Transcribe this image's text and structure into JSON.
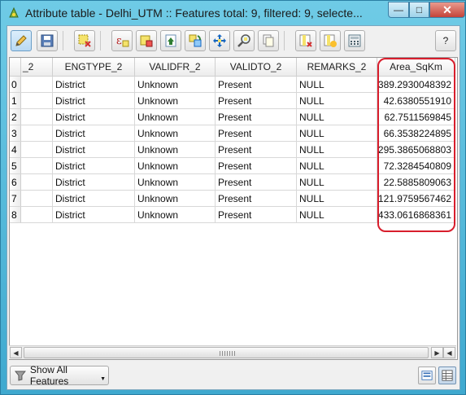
{
  "window": {
    "title": "Attribute table - Delhi_UTM :: Features total: 9, filtered: 9, selecte...",
    "minimize_glyph": "—",
    "maximize_glyph": "□",
    "close_glyph": "✕"
  },
  "toolbar": {
    "help_label": "?"
  },
  "table": {
    "columns": [
      "_2",
      "ENGTYPE_2",
      "VALIDFR_2",
      "VALIDTO_2",
      "REMARKS_2",
      "Area_SqKm"
    ],
    "rows": [
      {
        "id": "0",
        "cells": [
          "",
          "District",
          "Unknown",
          "Present",
          "NULL",
          "389.2930048392"
        ]
      },
      {
        "id": "1",
        "cells": [
          "",
          "District",
          "Unknown",
          "Present",
          "NULL",
          "42.6380551910"
        ]
      },
      {
        "id": "2",
        "cells": [
          "",
          "District",
          "Unknown",
          "Present",
          "NULL",
          "62.7511569845"
        ]
      },
      {
        "id": "3",
        "cells": [
          "",
          "District",
          "Unknown",
          "Present",
          "NULL",
          "66.3538224895"
        ]
      },
      {
        "id": "4",
        "cells": [
          "",
          "District",
          "Unknown",
          "Present",
          "NULL",
          "295.3865068803"
        ]
      },
      {
        "id": "5",
        "cells": [
          "",
          "District",
          "Unknown",
          "Present",
          "NULL",
          "72.3284540809"
        ]
      },
      {
        "id": "6",
        "cells": [
          "",
          "District",
          "Unknown",
          "Present",
          "NULL",
          "22.5885809063"
        ]
      },
      {
        "id": "7",
        "cells": [
          "",
          "District",
          "Unknown",
          "Present",
          "NULL",
          "121.9759567462"
        ]
      },
      {
        "id": "8",
        "cells": [
          "",
          "District",
          "Unknown",
          "Present",
          "NULL",
          "433.0616868361"
        ]
      }
    ],
    "highlight_color": "#d81e2c"
  },
  "footer": {
    "show_features_label": "Show All Features"
  },
  "colors": {
    "window_frame": "#5fc0dc",
    "close_button": "#c4443a"
  }
}
